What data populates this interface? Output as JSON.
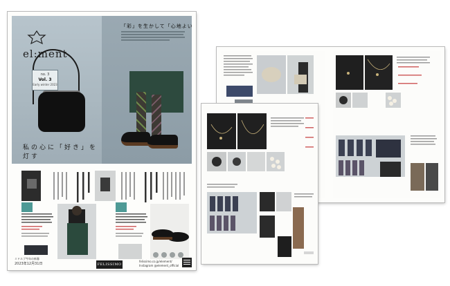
{
  "cover": {
    "logo": "el:ment",
    "issue_label": "no. 3",
    "issue_number": "Vol. 3",
    "issue_date": "Early winter 2023",
    "headline": "「彩」を生かして「心地よい」が広がる、",
    "tagline": "私の心に「好き」を灯す",
    "footer_sub": "ミドルブ今年の新春",
    "footer_date": "2023年12月31日",
    "brand": "FELISSIMO",
    "url": "felissimo.co.jp/element/",
    "social": "Instagram @element_official"
  },
  "colors": {
    "hero_left": "#b7c4cc",
    "hero_right": "#8c9ca6",
    "coat_green": "#2d4a3e",
    "accent_red": "#d06060"
  }
}
